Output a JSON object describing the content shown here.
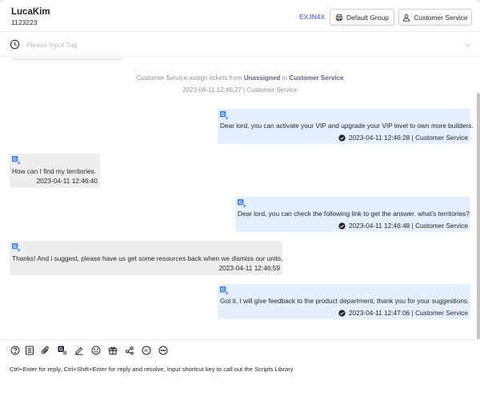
{
  "header": {
    "user_name": "LucaKim",
    "user_id": "1123223",
    "ticket_code": "EXJN4X",
    "group_button": "Default Group",
    "service_button": "Customer Service"
  },
  "tag_bar": {
    "placeholder": "Please Input Tag"
  },
  "chat": {
    "system": {
      "prefix": "Customer Service assign tickets from",
      "from": "Unassigned",
      "mid": "to",
      "to": "Customer Service",
      "time": "2023-04-11 12:46:27 | Customer Service"
    },
    "messages": [
      {
        "direction": "out",
        "text": "Dear lord, you can activate your VIP and upgrade your VIP level to own more builders.",
        "meta": "2023-04-11 12:46:28 | Customer Service"
      },
      {
        "direction": "in",
        "text": "How can I find my territories.",
        "meta": "2023-04-11 12:46:40"
      },
      {
        "direction": "out",
        "text": "Dear lord, you can check the following link to get the answer. what's territories?",
        "meta": "2023-04-11 12:46:48 | Customer Service"
      },
      {
        "direction": "in",
        "text": "Thanks! And i suggest, please have us get some resources back when we dismiss our units.",
        "meta": "2023-04-11 12:46:59"
      },
      {
        "direction": "out",
        "text": "Got it, I will give feedback to the product department, thank you for your suggestions.",
        "meta": "2023-04-11 12:47:06 | Customer Service"
      }
    ]
  },
  "composer": {
    "tools": [
      "help-icon",
      "document-icon",
      "attachment-icon",
      "translate-icon",
      "edit-icon",
      "emoji-icon",
      "gift-icon",
      "share-icon",
      "ai-icon",
      "more-icon"
    ],
    "placeholder": "Ctrl+Enter for reply, Ctrl+Shift+Enter for reply and resolve, Input shortcut key to call out the Scripts Library"
  },
  "colors": {
    "accent": "#2f54eb",
    "outgoing_bubble": "#e4efff",
    "incoming_bubble": "#eeeeee",
    "muted_text": "#8f959e"
  }
}
